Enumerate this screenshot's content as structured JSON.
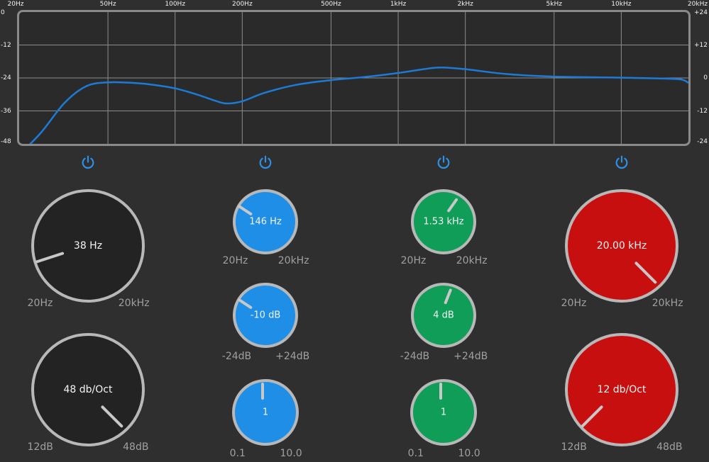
{
  "graph": {
    "freq_labels": [
      "20Hz",
      "50Hz",
      "100Hz",
      "200Hz",
      "500Hz",
      "1kHz",
      "2kHz",
      "5kHz",
      "10kHz",
      "20kHz"
    ],
    "db_left": [
      "0",
      "-12",
      "-24",
      "-36",
      "-48"
    ],
    "db_right": [
      "+24",
      "+12",
      "0",
      "-12",
      "-24"
    ],
    "curve_color": "#1d7bd6",
    "response_curve_db": [
      {
        "freq": 20,
        "db": -52
      },
      {
        "freq": 25,
        "db": -44
      },
      {
        "freq": 32,
        "db": -33
      },
      {
        "freq": 40,
        "db": -27
      },
      {
        "freq": 50,
        "db": -25.6
      },
      {
        "freq": 65,
        "db": -25.8
      },
      {
        "freq": 80,
        "db": -26.5
      },
      {
        "freq": 100,
        "db": -27.8
      },
      {
        "freq": 125,
        "db": -30
      },
      {
        "freq": 150,
        "db": -32.2
      },
      {
        "freq": 170,
        "db": -33.3
      },
      {
        "freq": 200,
        "db": -32.5
      },
      {
        "freq": 250,
        "db": -29.5
      },
      {
        "freq": 350,
        "db": -26.5
      },
      {
        "freq": 500,
        "db": -24.8
      },
      {
        "freq": 700,
        "db": -23.7
      },
      {
        "freq": 1000,
        "db": -22.2
      },
      {
        "freq": 1300,
        "db": -20.8
      },
      {
        "freq": 1550,
        "db": -20.2
      },
      {
        "freq": 2000,
        "db": -20.8
      },
      {
        "freq": 3000,
        "db": -22.5
      },
      {
        "freq": 5000,
        "db": -23.5
      },
      {
        "freq": 10000,
        "db": -23.9
      },
      {
        "freq": 17000,
        "db": -24.3
      },
      {
        "freq": 19000,
        "db": -24.8
      },
      {
        "freq": 20000,
        "db": -25.8
      }
    ]
  },
  "bands": [
    {
      "id": "low-cut",
      "color": "#232323",
      "power_on": true,
      "knobs": [
        {
          "id": "low-cut-freq",
          "value": "38 Hz",
          "min": "20Hz",
          "max": "20kHz",
          "fraction": 0.1
        },
        {
          "id": "low-cut-slope",
          "value": "48 db/Oct",
          "min": "12dB",
          "max": "48dB",
          "fraction": 1.0
        }
      ]
    },
    {
      "id": "peak-1",
      "color": "#1e8ee6",
      "power_on": true,
      "knobs": [
        {
          "id": "peak-1-freq",
          "value": "146 Hz",
          "min": "20Hz",
          "max": "20kHz",
          "fraction": 0.29
        },
        {
          "id": "peak-1-gain",
          "value": "-10 dB",
          "min": "-24dB",
          "max": "+24dB",
          "fraction": 0.29
        },
        {
          "id": "peak-1-q",
          "value": "1",
          "min": "0.1",
          "max": "10.0",
          "fraction": 0.5
        }
      ]
    },
    {
      "id": "peak-2",
      "color": "#0f9d58",
      "power_on": true,
      "knobs": [
        {
          "id": "peak-2-freq",
          "value": "1.53 kHz",
          "min": "20Hz",
          "max": "20kHz",
          "fraction": 0.63
        },
        {
          "id": "peak-2-gain",
          "value": "4 dB",
          "min": "-24dB",
          "max": "+24dB",
          "fraction": 0.58
        },
        {
          "id": "peak-2-q",
          "value": "1",
          "min": "0.1",
          "max": "10.0",
          "fraction": 0.5
        }
      ]
    },
    {
      "id": "high-cut",
      "color": "#c80f0f",
      "power_on": true,
      "knobs": [
        {
          "id": "high-cut-freq",
          "value": "20.00 kHz",
          "min": "20Hz",
          "max": "20kHz",
          "fraction": 1.0
        },
        {
          "id": "high-cut-slope",
          "value": "12 db/Oct",
          "min": "12dB",
          "max": "48dB",
          "fraction": 0.0
        }
      ]
    }
  ]
}
